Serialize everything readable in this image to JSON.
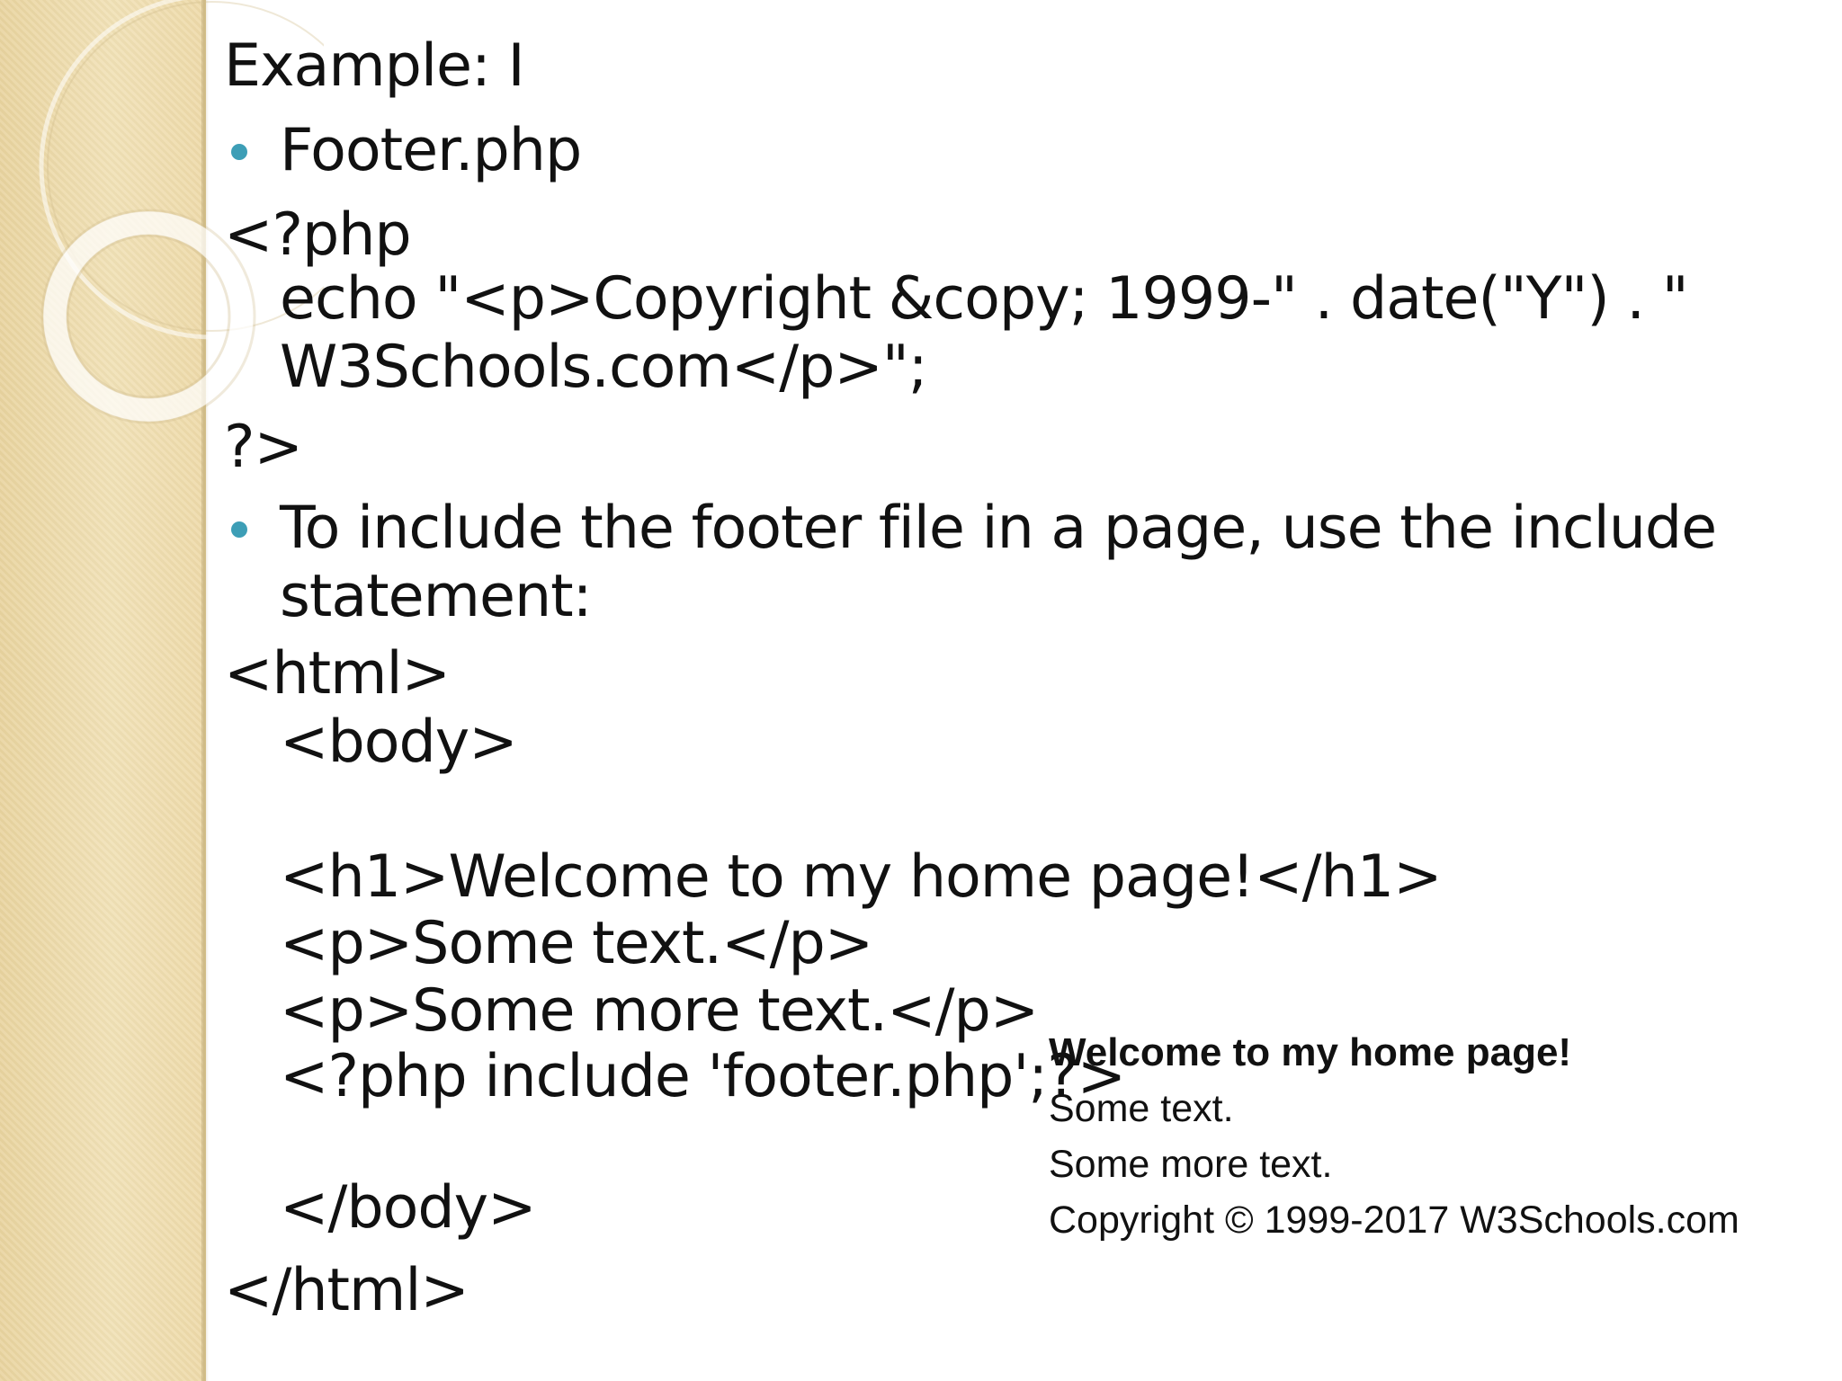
{
  "slide": {
    "heading": "Example: I",
    "bullet1": "Footer.php",
    "code1": [
      "<?php",
      "echo \"<p>Copyright &copy; 1999-\" . date(\"Y\") . \"",
      "W3Schools.com</p>\";",
      "?>"
    ],
    "bullet2_lines": [
      "To include the footer file in a page, use the include",
      "statement:"
    ],
    "code2": [
      "<html>",
      "<body>",
      "<h1>Welcome to my home page!</h1>",
      "<p>Some text.</p>",
      "<p>Some more text.</p>",
      "<?php include 'footer.php';?>",
      "</body>",
      "</html>"
    ],
    "output": {
      "title": "Welcome to my home page!",
      "line1": "Some text.",
      "line2": "Some more text.",
      "line3": "Copyright © 1999-2017 W3Schools.com"
    }
  },
  "colors": {
    "bullet": "#3d9eb6",
    "sidebar": "#eedcae"
  }
}
